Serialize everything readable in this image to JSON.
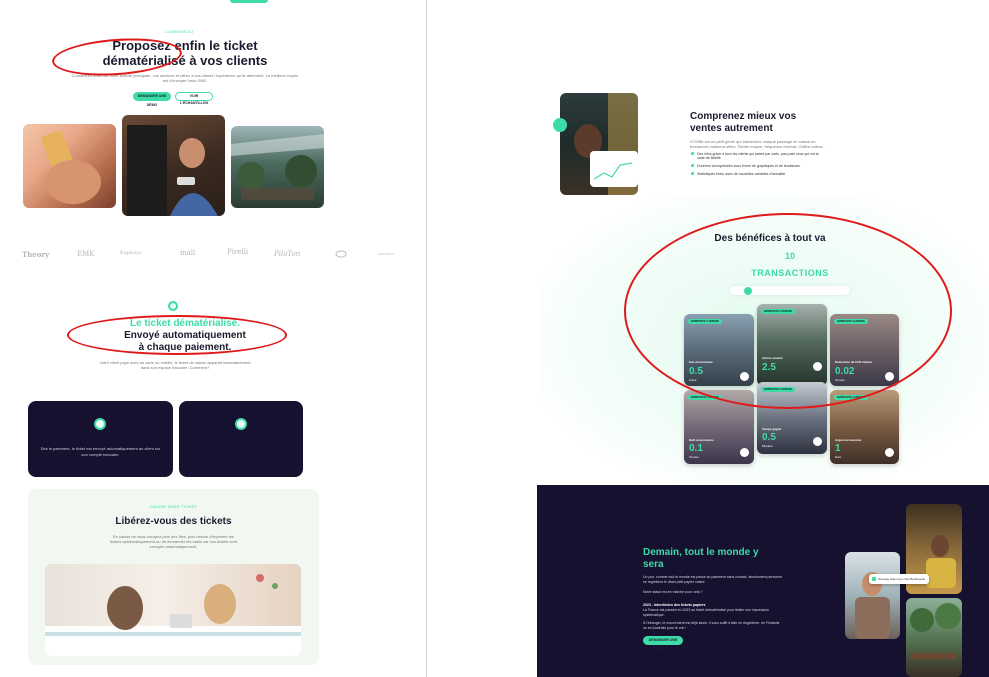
{
  "left": {
    "hero": {
      "eyebrow": "COMMENCEZ",
      "title_line1": "Proposez enfin le ticket",
      "title_line2": "dématérialisé à vos clients",
      "subtitle": "Concentrez-vous sur votre activité principale, vos services et offrez à vos clients l'expérience qu'ils attendent. Le meilleur moyen est d'envoyer l'avis SMS.",
      "primary_button": "DEMANDER UNE DÉMO",
      "secondary_button": "VOIR L'ÉCHANTILLON"
    },
    "logos": [
      "Theory",
      "EMK",
      "Kapnays",
      "mali",
      "Pirelli",
      "PiloTon",
      "",
      "OXYGENA"
    ],
    "section2": {
      "title_line1": "Le ticket dématérialisé.",
      "title_line2": "Envoyé automatiquement",
      "title_line3": "à chaque paiement.",
      "subtitle": "Votre client paye avec sa carte ou mobile, le ticket de caisse apparaît instantanément dans son espace bancaire. Comment?"
    },
    "cards": [
      {
        "text": "Dès le paiement, le ticket est envoyé automatiquement au client sur son compte bancaire."
      },
      {
        "text": ""
      }
    ],
    "liberez": {
      "eyebrow": "CAISSE SANS TICKET",
      "title": "Libérez-vous des tickets",
      "text": "En caisse ne vous occupez plus des files, plus besoin d'imprimer les tickets systématiquement ou de demander les mails car vos tickets sont envoyés automatiquement."
    }
  },
  "right": {
    "comprendre": {
      "title_line1": "Comprenez mieux vos",
      "title_line2": "ventes autrement",
      "intro": "KOOBii est un petit génie qui transforme chaque passage en caisse en tendances vraiment utiles. Panier moyen, fréquence d'achat, Chiffre-valeur...",
      "bullets": [
        "Des infos grâce à tous les clients qui paient par carte, pas juste ceux qui ont la carte de fidélité.",
        "Données anonymisées sous forme de graphiques et de tendances.",
        "Statistiques fines, avec de nouvelles variables d'actualité."
      ]
    },
    "benefices": {
      "title": "Des bénéfices à tout va",
      "count": "10",
      "label": "TRANSACTIONS",
      "slider_value": 0.1
    },
    "tiles": [
      {
        "badge": "EMPREINTE CARBONE",
        "label": "Eau économisée",
        "value": "0.5",
        "unit": "Litres"
      },
      {
        "badge": "EMPREINTE CARBONE",
        "label": "Arbres sauvés",
        "value": "2.5",
        "unit": ""
      },
      {
        "badge": "EMPREINTE CARBONE",
        "label": "Emissions de CO2 évitées",
        "value": "0.02",
        "unit": "Tonnes"
      },
      {
        "badge": "EMPREINTE CARBONE",
        "label": "Kwh économisés",
        "value": "0.1",
        "unit": "Tonnes"
      },
      {
        "badge": "EMPREINTE CARBONE",
        "label": "Temps gagné",
        "value": "0.5",
        "unit": "Minutes"
      },
      {
        "badge": "EMPREINTE CARBONE",
        "label": "Argent économisé",
        "value": "1",
        "unit": "Euro"
      }
    ],
    "band": {
      "title_line1": "Demain, tout le monde y",
      "title_line2": "sera",
      "text1": "Un jour, comme tout le monde est passé au paiement sans contact, absolument personne ne regrettera le vilain petit papier volant.",
      "text2": "Notre statut est en marche pour cela ?",
      "text3": "2023 - Interdiction des tickets papiers",
      "text4": "La France est passée en 2023 au ticket dématérialisé pour limiter son impression systématique.",
      "text5": "À l'étranger, le mouvement est déjà lancé, il vous suffit d'aller en Angleterre, en Finlande ou en Australie pour le voir !",
      "button": "DEMANDER UNE DÉMO",
      "notification": "Nouveau ticket reçu chez Boulangerie"
    }
  },
  "colors": {
    "accent": "#3ddba8",
    "dark": "#15112e",
    "annotation": "#e01a1a"
  }
}
